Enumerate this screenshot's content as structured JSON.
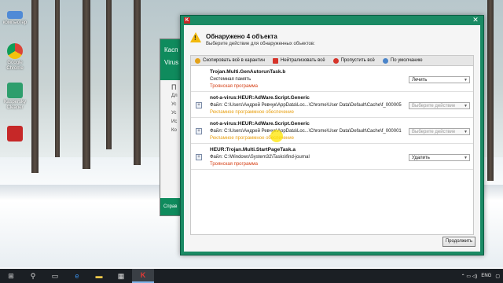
{
  "desktop": {
    "icons": [
      {
        "label": "компьютер",
        "color": "#4f8ad6"
      },
      {
        "label": "Google Chrome",
        "color": "#e9e9e9"
      },
      {
        "label": "Kaspersky Cleaner",
        "color": "#2e9e6d"
      },
      {
        "label": "",
        "color": "#c62828"
      }
    ]
  },
  "bg_window": {
    "title_lines": [
      "Касп",
      "Virus"
    ],
    "text_lines": [
      "П",
      "Дл",
      "Ус",
      "Ус",
      "Ис",
      "Ко"
    ],
    "footer": "Справ"
  },
  "dialog": {
    "title": "Обнаружено 4 объекта",
    "subtitle": "Выберите действие для обнаруженных объектов:",
    "close_glyph": "✕",
    "toolbar": {
      "quarantine_all": "Скопировать всё в карантин",
      "neutralize_all": "Нейтрализовать всё",
      "skip_all": "Пропустить всё",
      "default": "По умолчанию"
    },
    "threats": [
      {
        "name": "Trojan.Multi.GenAutorunTask.b",
        "path": "Системная память",
        "category": "Троянская программа",
        "category_color": "#d64016",
        "action": "Лечить",
        "expandable": false,
        "disabled": false
      },
      {
        "name": "not-a-virus:HEUR:AdWare.Script.Generic",
        "path": "Файл: C:\\Users\\Андрей Ревчук\\AppData\\Loc...\\Chrome\\User Data\\Default\\Cache\\f_000005",
        "category": "Рекламное программное обеспечение",
        "category_color": "#e8a012",
        "action": "Выберите действие",
        "expandable": true,
        "disabled": true
      },
      {
        "name": "not-a-virus:HEUR:AdWare.Script.Generic",
        "path": "Файл: C:\\Users\\Андрей Ревчук\\AppData\\Loc...\\Chrome\\User Data\\Default\\Cache\\f_000001",
        "category": "Рекламное программное обеспечение",
        "category_color": "#e8a012",
        "action": "Выберите действие",
        "expandable": true,
        "disabled": true
      },
      {
        "name": "HEUR:Trojan.Multi.StartPageTask.a",
        "path": "Файл: C:\\Windows\\System32\\Tasks\\find-journal",
        "category": "Троянская программа",
        "category_color": "#d64016",
        "action": "Удалить",
        "expandable": true,
        "disabled": false
      }
    ],
    "continue_label": "Продолжить"
  },
  "taskbar": {
    "lang": "ENG",
    "tray_glyphs": "⌃ ▭ ◁)"
  },
  "colors": {
    "accent": "#1a8a64",
    "warning": "#f2b90c",
    "trojan": "#d64016",
    "adware": "#e8a012"
  }
}
